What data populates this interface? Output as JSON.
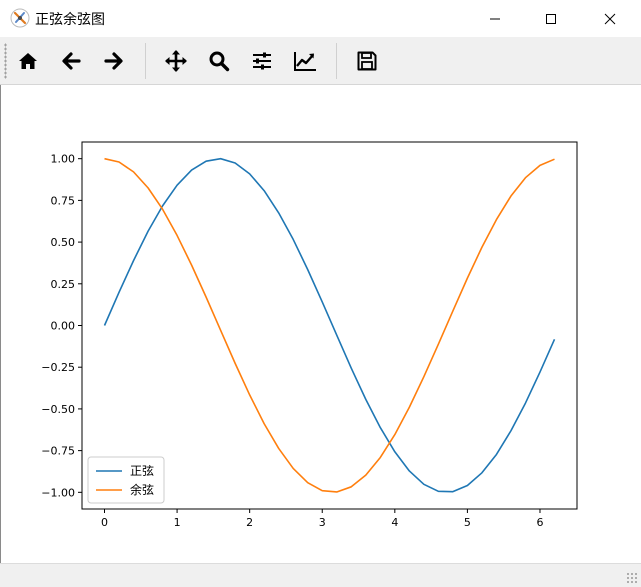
{
  "window": {
    "title": "正弦余弦图",
    "controls": {
      "minimize": "minimize",
      "maximize": "maximize",
      "close": "close"
    }
  },
  "toolbar": {
    "tools": [
      {
        "id": "home",
        "icon": "home-icon"
      },
      {
        "id": "back",
        "icon": "arrow-left-icon"
      },
      {
        "id": "forward",
        "icon": "arrow-right-icon"
      },
      {
        "id": "pan",
        "icon": "move-icon"
      },
      {
        "id": "zoom",
        "icon": "search-icon"
      },
      {
        "id": "configure",
        "icon": "sliders-icon"
      },
      {
        "id": "edit",
        "icon": "line-chart-icon"
      },
      {
        "id": "save",
        "icon": "save-icon"
      }
    ]
  },
  "chart_data": {
    "type": "line",
    "title": "",
    "xlabel": "",
    "ylabel": "",
    "xlim": [
      -0.31,
      6.51
    ],
    "ylim": [
      -1.1,
      1.1
    ],
    "xticks": [
      0,
      1,
      2,
      3,
      4,
      5,
      6
    ],
    "xtick_labels": [
      "0",
      "1",
      "2",
      "3",
      "4",
      "5",
      "6"
    ],
    "yticks": [
      -1.0,
      -0.75,
      -0.5,
      -0.25,
      0.0,
      0.25,
      0.5,
      0.75,
      1.0
    ],
    "ytick_labels": [
      "−1.00",
      "−0.75",
      "−0.50",
      "−0.25",
      "0.00",
      "0.25",
      "0.50",
      "0.75",
      "1.00"
    ],
    "grid": false,
    "legend_position": "lower-left",
    "x": [
      0.0,
      0.2,
      0.4,
      0.6,
      0.8,
      1.0,
      1.2,
      1.4,
      1.6,
      1.8,
      2.0,
      2.2,
      2.4,
      2.6,
      2.8,
      3.0,
      3.2,
      3.4,
      3.6,
      3.8,
      4.0,
      4.2,
      4.4,
      4.6,
      4.8,
      5.0,
      5.2,
      5.4,
      5.6,
      5.8,
      6.0,
      6.2
    ],
    "series": [
      {
        "name": "正弦",
        "color": "#1f77b4",
        "values": [
          0.0,
          0.199,
          0.389,
          0.565,
          0.717,
          0.841,
          0.932,
          0.985,
          1.0,
          0.974,
          0.909,
          0.808,
          0.675,
          0.516,
          0.335,
          0.141,
          -0.058,
          -0.256,
          -0.443,
          -0.612,
          -0.757,
          -0.872,
          -0.952,
          -0.994,
          -0.996,
          -0.959,
          -0.883,
          -0.773,
          -0.631,
          -0.465,
          -0.279,
          -0.083
        ]
      },
      {
        "name": "余弦",
        "color": "#ff7f0e",
        "values": [
          1.0,
          0.98,
          0.921,
          0.825,
          0.697,
          0.54,
          0.362,
          0.17,
          -0.029,
          -0.227,
          -0.416,
          -0.589,
          -0.737,
          -0.857,
          -0.942,
          -0.99,
          -0.998,
          -0.967,
          -0.897,
          -0.791,
          -0.654,
          -0.49,
          -0.307,
          -0.112,
          0.087,
          0.284,
          0.469,
          0.635,
          0.776,
          0.886,
          0.96,
          0.997
        ]
      }
    ]
  }
}
